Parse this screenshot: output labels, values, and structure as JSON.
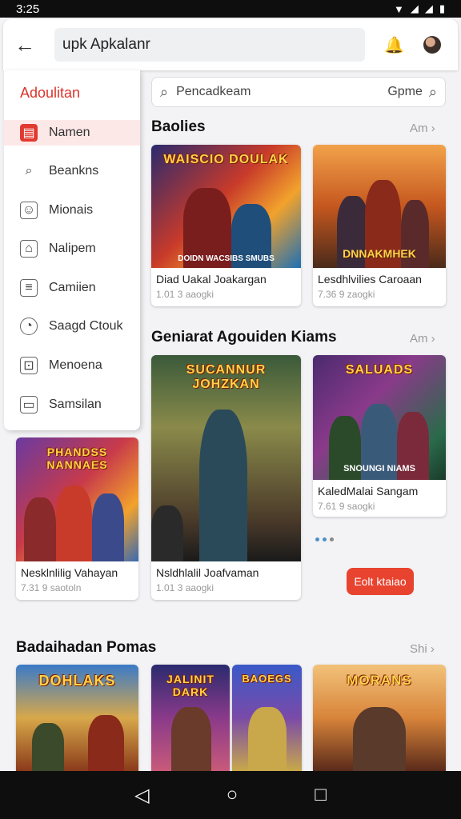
{
  "status": {
    "time": "3:25",
    "wifi_icon": "wifi-icon",
    "signal_icon": "signal-icon",
    "battery_icon": "battery-icon"
  },
  "app_bar": {
    "title": "upk Apkalanr"
  },
  "sidebar": {
    "title": "Adoulitan",
    "items": [
      {
        "label": "Namen",
        "icon": "book-icon"
      },
      {
        "label": "Beankns",
        "icon": "search-icon"
      },
      {
        "label": "Mionais",
        "icon": "person-icon"
      },
      {
        "label": "Nalipem",
        "icon": "house-icon"
      },
      {
        "label": "Camiien",
        "icon": "list-icon"
      },
      {
        "label": "Saagd Ctouk",
        "icon": "clock-icon"
      },
      {
        "label": "Menoena",
        "icon": "gamepad-icon"
      },
      {
        "label": "Samsilan",
        "icon": "screen-icon"
      }
    ]
  },
  "search": {
    "placeholder": "Pencadkeam",
    "right_text": "Gpme"
  },
  "sections": {
    "s1": {
      "title": "Baolies",
      "more": "Am"
    },
    "s2": {
      "title": "Geniarat Agouiden Kiams",
      "more": "Am"
    },
    "s3": {
      "title": "Badaihadan Pomas",
      "more": "Shi"
    }
  },
  "cards": {
    "c1": {
      "banner": "WAISCIO DOULAK",
      "caption": "DOIDN WACSIBS SMUBS",
      "title": "Diad Uakal Joakargan",
      "sub": "1.01 3 aaogki"
    },
    "c2": {
      "banner": "",
      "caption": "DNNAKMHEK",
      "title": "Lesdhlvilies Caroaan",
      "sub": "7.36 9 zaogki"
    },
    "c3": {
      "banner": "SUCANNUR JOHZKAN",
      "caption": "",
      "title": "Nsldhlalil Joafvaman",
      "sub": "1.01 3 aaogki"
    },
    "c4": {
      "banner": "SALUADS",
      "caption": "SNOUNGI NIAMS",
      "title": "KaledMalai Sangam",
      "sub": "7.61 9 saogki"
    },
    "c5": {
      "banner": "PHANDSS NANNAES",
      "caption": "",
      "title": "Nesklnlilig Vahayan",
      "sub": "7.31 9 saotoln"
    },
    "c6": {
      "banner": "DOHLAKS",
      "caption": ""
    },
    "c7": {
      "banner": "JALINIT DARK",
      "caption": ""
    },
    "c8": {
      "banner": "BAOEGS",
      "caption": ""
    },
    "c9": {
      "banner": "MORANS",
      "caption": ""
    }
  },
  "cta": {
    "label": "Eolt ktaiao"
  },
  "nav": {
    "back": "◁",
    "home": "○",
    "recents": "□"
  }
}
